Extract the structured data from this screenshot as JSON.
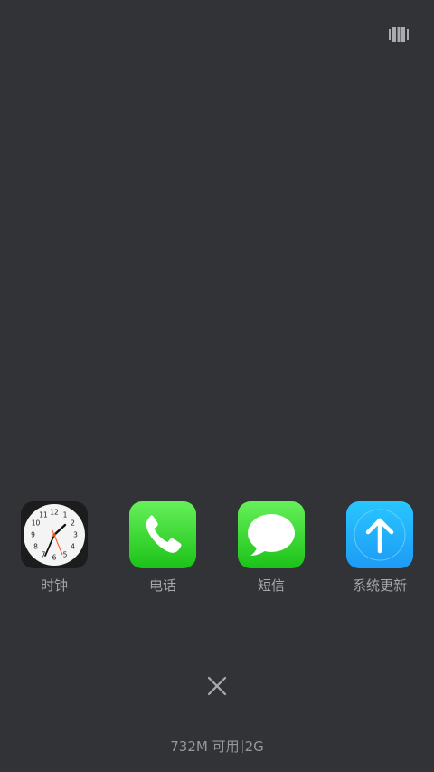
{
  "top_bar": {
    "view_toggle_icon": "card-view-icon"
  },
  "apps": [
    {
      "label": "时钟",
      "icon": "clock-icon",
      "color": "#1c1c1c"
    },
    {
      "label": "电话",
      "icon": "phone-icon",
      "color": "#2ccf22"
    },
    {
      "label": "短信",
      "icon": "message-bubble-icon",
      "color": "#2ccf22"
    },
    {
      "label": "系统更新",
      "icon": "arrow-up-icon",
      "color": "#1fb0fb"
    }
  ],
  "close_icon": "close-icon",
  "memory": {
    "available": "732M 可用",
    "total": "2G"
  },
  "colors": {
    "background": "#313337",
    "label_text": "#a6a8ac"
  }
}
